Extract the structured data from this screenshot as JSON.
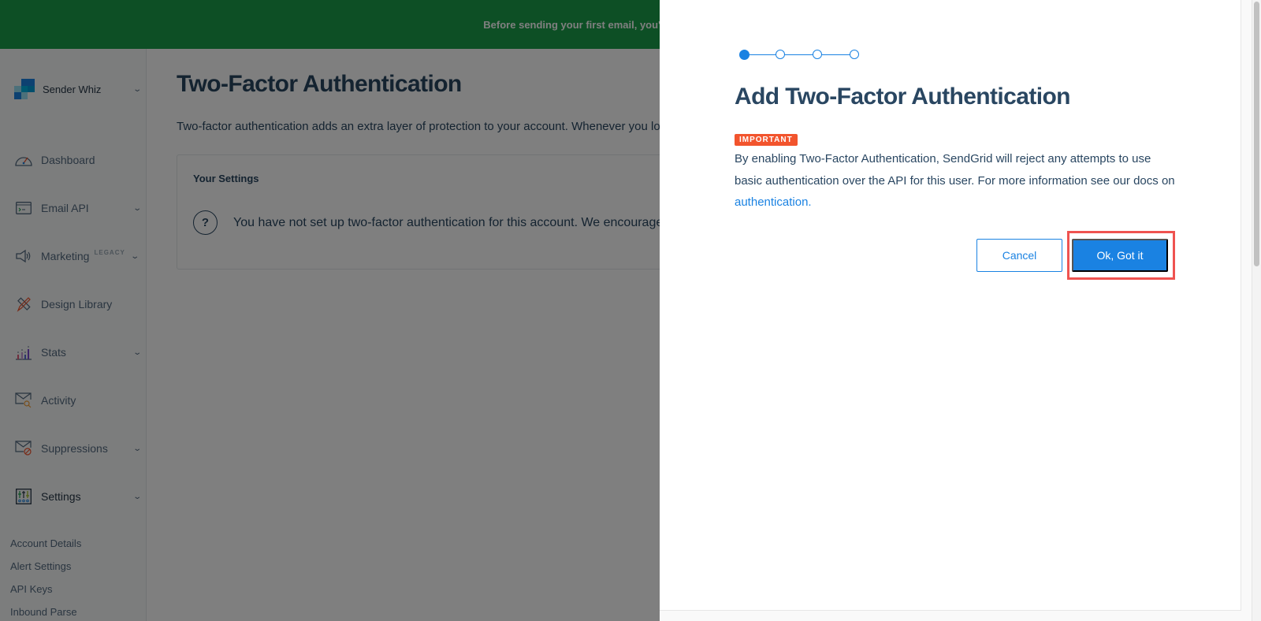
{
  "banner": {
    "text": "Before sending your first email, you'll need to create a sender identity."
  },
  "sidebar": {
    "account_name": "Sender Whiz",
    "items": [
      {
        "label": "Dashboard",
        "icon": "dashboard-gauge-icon",
        "expandable": false
      },
      {
        "label": "Email API",
        "icon": "terminal-window-icon",
        "expandable": true
      },
      {
        "label": "Marketing",
        "badge": "LEGACY",
        "icon": "megaphone-icon",
        "expandable": true
      },
      {
        "label": "Design Library",
        "icon": "pencil-ruler-icon",
        "expandable": false
      },
      {
        "label": "Stats",
        "icon": "bar-chart-icon",
        "expandable": true
      },
      {
        "label": "Activity",
        "icon": "envelope-search-icon",
        "expandable": false
      },
      {
        "label": "Suppressions",
        "icon": "envelope-blocked-icon",
        "expandable": true
      },
      {
        "label": "Settings",
        "icon": "sliders-icon",
        "expandable": true
      }
    ],
    "settings_subitems": [
      "Account Details",
      "Alert Settings",
      "API Keys",
      "Inbound Parse"
    ]
  },
  "main": {
    "title": "Two-Factor Authentication",
    "description": "Two-factor authentication adds an extra layer of protection to your account. Whenever you log in,",
    "card": {
      "title": "Your Settings",
      "message": "You have not set up two-factor authentication for this account. We encourage you to"
    }
  },
  "modal": {
    "stepper": {
      "total_steps": 4,
      "current_step": 1
    },
    "title": "Add Two-Factor Authentication",
    "badge": "IMPORTANT",
    "body_text": "By enabling Two-Factor Authentication, SendGrid will reject any attempts to use basic authentication over the API for this user. For more information see our docs on ",
    "link_text": "authentication.",
    "cancel_label": "Cancel",
    "ok_label": "Ok, Got it"
  },
  "colors": {
    "banner_green": "#1a9e4b",
    "brand_blue": "#1a82e2",
    "text_navy": "#294661",
    "badge_orange": "#f2542d",
    "highlight_red": "#ef5350"
  }
}
